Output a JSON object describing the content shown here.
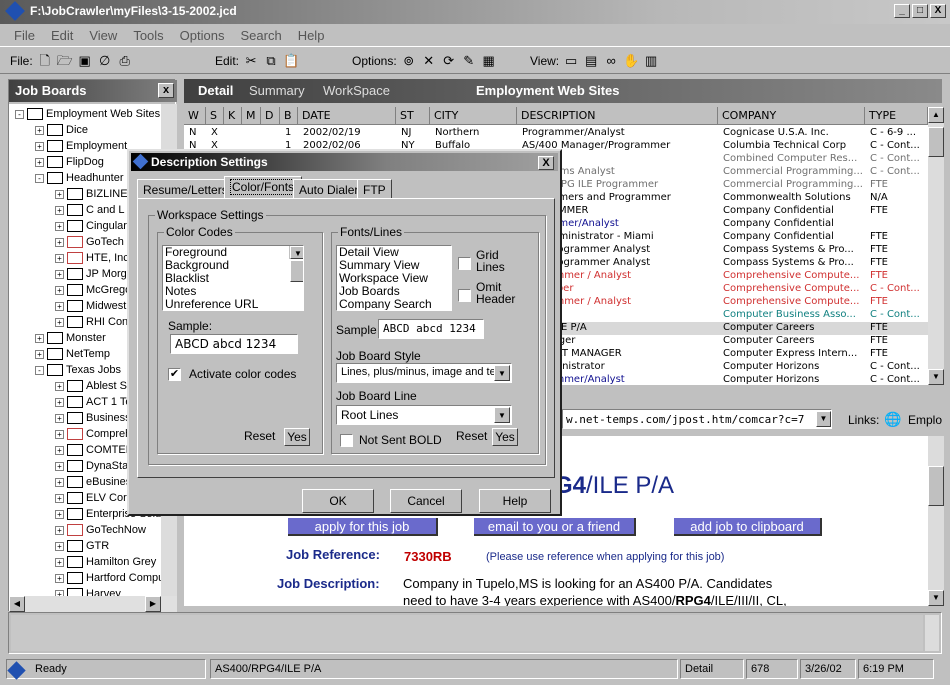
{
  "window": {
    "title": "F:\\JobCrawler\\myFiles\\3-15-2002.jcd",
    "min": "_",
    "max": "□",
    "close": "X"
  },
  "menu": [
    "File",
    "Edit",
    "View",
    "Tools",
    "Options",
    "Search",
    "Help"
  ],
  "toolbar": {
    "file_label": "File:",
    "edit_label": "Edit:",
    "options_label": "Options:",
    "view_label": "View:"
  },
  "left": {
    "title": "Job Boards",
    "close": "x",
    "tree": [
      {
        "label": "Employment Web Sites",
        "level": 0,
        "pm": "-",
        "red": false
      },
      {
        "label": "Dice",
        "level": 1,
        "pm": "+",
        "red": false
      },
      {
        "label": "Employment",
        "level": 1,
        "pm": "+",
        "red": false
      },
      {
        "label": "FlipDog",
        "level": 1,
        "pm": "+",
        "red": false
      },
      {
        "label": "Headhunter",
        "level": 1,
        "pm": "-",
        "red": false
      },
      {
        "label": "BIZLINE",
        "level": 2,
        "pm": "+",
        "red": false
      },
      {
        "label": "C and L",
        "level": 2,
        "pm": "+",
        "red": false
      },
      {
        "label": "Cingular",
        "level": 2,
        "pm": "+",
        "red": false
      },
      {
        "label": "GoTech",
        "level": 2,
        "pm": "+",
        "red": true
      },
      {
        "label": "HTE, Inc",
        "level": 2,
        "pm": "+",
        "red": true
      },
      {
        "label": "JP Morgan",
        "level": 2,
        "pm": "+",
        "red": false
      },
      {
        "label": "McGregor",
        "level": 2,
        "pm": "+",
        "red": false
      },
      {
        "label": "Midwest",
        "level": 2,
        "pm": "+",
        "red": false
      },
      {
        "label": "RHI Consulting",
        "level": 2,
        "pm": "+",
        "red": false
      },
      {
        "label": "Monster",
        "level": 1,
        "pm": "+",
        "red": false
      },
      {
        "label": "NetTemp",
        "level": 1,
        "pm": "+",
        "red": false
      },
      {
        "label": "Texas Jobs",
        "level": 1,
        "pm": "-",
        "red": false
      },
      {
        "label": "Ablest Staffing",
        "level": 2,
        "pm": "+",
        "red": false
      },
      {
        "label": "ACT 1 Technical",
        "level": 2,
        "pm": "+",
        "red": false
      },
      {
        "label": "Business",
        "level": 2,
        "pm": "+",
        "red": false
      },
      {
        "label": "Comprehensive",
        "level": 2,
        "pm": "+",
        "red": true
      },
      {
        "label": "COMTEK",
        "level": 2,
        "pm": "+",
        "red": false
      },
      {
        "label": "DynaStaff",
        "level": 2,
        "pm": "+",
        "red": false
      },
      {
        "label": "eBusiness",
        "level": 2,
        "pm": "+",
        "red": false
      },
      {
        "label": "ELV Corp",
        "level": 2,
        "pm": "+",
        "red": false
      },
      {
        "label": "Enterprise Solutions",
        "level": 2,
        "pm": "+",
        "red": false
      },
      {
        "label": "GoTechNow",
        "level": 2,
        "pm": "+",
        "red": true
      },
      {
        "label": "GTR",
        "level": 2,
        "pm": "+",
        "red": false
      },
      {
        "label": "Hamilton Grey",
        "level": 2,
        "pm": "+",
        "red": false
      },
      {
        "label": "Hartford Computer",
        "level": 2,
        "pm": "+",
        "red": false
      },
      {
        "label": "Harvey",
        "level": 2,
        "pm": "+",
        "red": false
      }
    ]
  },
  "right": {
    "tabs": [
      "Detail",
      "Summary",
      "WorkSpace"
    ],
    "heading": "Employment Web Sites"
  },
  "grid": {
    "columns": [
      "W",
      "S",
      "K",
      "M",
      "D",
      "B",
      "DATE",
      "ST",
      "CITY",
      "DESCRIPTION",
      "COMPANY",
      "TYPE"
    ],
    "rows": [
      {
        "w": "N",
        "s": "X",
        "b": "1",
        "date": "2002/02/19",
        "st": "NJ",
        "city": "Northern",
        "desc": "Programmer/Analyst",
        "company": "Cognicase U.S.A. Inc.",
        "type": "C - 6-9 ...",
        "cc": "black",
        "dc": "black"
      },
      {
        "w": "N",
        "s": "X",
        "b": "1",
        "date": "2002/02/06",
        "st": "NY",
        "city": "Buffalo",
        "desc": "AS/400 Manager/Programmer",
        "company": "Columbia Technical Corp",
        "type": "C - Cont...",
        "cc": "black",
        "dc": "black"
      },
      {
        "w": "",
        "s": "",
        "b": "",
        "date": "",
        "st": "",
        "city": "",
        "desc": "mmer",
        "company": "Combined Computer Res...",
        "type": "C - Cont...",
        "cc": "gray",
        "dc": "gray"
      },
      {
        "w": "",
        "s": "",
        "b": "",
        "date": "",
        "st": "",
        "city": "",
        "desc": "B Systems Analyst",
        "company": "Commercial Programming...",
        "type": "C - Cont...",
        "cc": "gray",
        "dc": "gray"
      },
      {
        "w": "",
        "s": "",
        "b": "",
        "date": "",
        "st": "",
        "city": "",
        "desc": "S/400 RPG ILE Programmer",
        "company": "Commercial Programming...",
        "type": "FTE",
        "cc": "gray",
        "dc": "gray"
      },
      {
        "w": "",
        "s": "",
        "b": "",
        "date": "",
        "st": "",
        "city": "",
        "desc": "rogrammers and Programmer",
        "company": "Commonwealth Solutions",
        "type": "N/A",
        "cc": "black",
        "dc": "black"
      },
      {
        "w": "",
        "s": "",
        "b": "",
        "date": "",
        "st": "",
        "city": "",
        "desc": "ROGRAMMER",
        "company": "Company Confidential",
        "type": "FTE",
        "cc": "black",
        "dc": "black"
      },
      {
        "w": "",
        "s": "",
        "b": "",
        "date": "",
        "st": "",
        "city": "",
        "desc": "rogrammer/Analyst",
        "company": "Company Confidential",
        "type": "",
        "cc": "black",
        "dc": "blue"
      },
      {
        "w": "",
        "s": "",
        "b": "",
        "date": "",
        "st": "",
        "city": "",
        "desc": "rver Administrator - Miami",
        "company": "Company Confidential",
        "type": "FTE",
        "cc": "black",
        "dc": "black"
      },
      {
        "w": "",
        "s": "",
        "b": "",
        "date": "",
        "st": "",
        "city": "",
        "desc": "/400 Programmer Analyst",
        "company": "Compass Systems & Pro...",
        "type": "FTE",
        "cc": "black",
        "dc": "black"
      },
      {
        "w": "",
        "s": "",
        "b": "",
        "date": "",
        "st": "",
        "city": "",
        "desc": "/400 Programmer Analyst",
        "company": "Compass Systems & Pro...",
        "type": "FTE",
        "cc": "black",
        "dc": "black"
      },
      {
        "w": "",
        "s": "",
        "b": "",
        "date": "",
        "st": "",
        "city": "",
        "desc": "Programmer / Analyst",
        "company": "Comprehensive Compute...",
        "type": "FTE",
        "cc": "red",
        "dc": "red"
      },
      {
        "w": "",
        "s": "",
        "b": "",
        "date": "",
        "st": "",
        "city": "",
        "desc": "Developer",
        "company": "Comprehensive Compute...",
        "type": "C - Cont...",
        "cc": "red",
        "dc": "red"
      },
      {
        "w": "",
        "s": "",
        "b": "",
        "date": "",
        "st": "",
        "city": "",
        "desc": "Programmer / Analyst",
        "company": "Comprehensive Compute...",
        "type": "FTE",
        "cc": "red",
        "dc": "red"
      },
      {
        "w": "",
        "s": "",
        "b": "",
        "date": "",
        "st": "",
        "city": "",
        "desc": "n Lead",
        "company": "Computer Business Asso...",
        "type": "C - Cont...",
        "cc": "teal",
        "dc": "teal"
      },
      {
        "w": "",
        "s": "",
        "b": "",
        "date": "",
        "st": "",
        "city": "",
        "desc": "RPG4/ILE P/A",
        "company": "Computer Careers",
        "type": "FTE",
        "cc": "black",
        "dc": "black",
        "sel": true
      },
      {
        "w": "",
        "s": "",
        "b": "",
        "date": "",
        "st": "",
        "city": "",
        "desc": "S Manager",
        "company": "Computer Careers",
        "type": "FTE",
        "cc": "black",
        "dc": "black"
      },
      {
        "w": "",
        "s": "",
        "b": "",
        "date": "",
        "st": "",
        "city": "",
        "desc": "SUPPORT MANAGER",
        "company": "Computer Express Intern...",
        "type": "FTE",
        "cc": "black",
        "dc": "black"
      },
      {
        "w": "",
        "s": "",
        "b": "",
        "date": "",
        "st": "",
        "city": "",
        "desc": "se Administrator",
        "company": "Computer Horizons",
        "type": "C - Cont...",
        "cc": "black",
        "dc": "black"
      },
      {
        "w": "",
        "s": "",
        "b": "",
        "date": "",
        "st": "",
        "city": "",
        "desc": "Programmer/Analyst",
        "company": "Computer Horizons",
        "type": "C - Cont...",
        "cc": "black",
        "dc": "blue"
      }
    ]
  },
  "urlbar": {
    "url": "w.net-temps.com/jpost.htm/comcar?c=7",
    "links": "Links:",
    "emplo": "Emplo"
  },
  "browser": {
    "heading_bold": "G4",
    "heading_rest": "/ILE P/A",
    "btn_apply": "apply for this job",
    "btn_email": "email to you or a friend",
    "btn_clip": "add job to clipboard",
    "ref_label": "Job Reference:",
    "ref_value": "7330RB",
    "ref_note": "(Please use reference when applying for this job)",
    "desc_label": "Job Description:",
    "desc_line1": "Company in Tupelo,MS is looking for an AS400 P/A. Candidates",
    "desc_line2_a": "need to have 3-4 years experience with AS400/",
    "desc_line2_b": "RPG4",
    "desc_line2_c": "/ILE/III/II, CL,"
  },
  "status": {
    "ready": "Ready",
    "job": "AS400/RPG4/ILE P/A",
    "view": "Detail",
    "count": "678",
    "date": "3/26/02",
    "time": "6:19 PM"
  },
  "dialog": {
    "title": "Description Settings",
    "close": "X",
    "tabs": [
      "Resume/Letters",
      "Color/Fonts",
      "Auto Dialer",
      "FTP"
    ],
    "workspace_group": "Workspace Settings",
    "color_codes_group": "Color Codes",
    "color_codes": [
      "Foreground",
      "Background",
      "Blacklist",
      "Notes",
      "Unreference URL"
    ],
    "sample_label": "Sample:",
    "sample_text": "ABCD abcd 1234",
    "activate": "Activate color codes",
    "activate_checked": true,
    "reset": "Reset",
    "yes": "Yes",
    "fonts_group": "Fonts/Lines",
    "fonts_list": [
      "Detail View",
      "Summary View",
      "Workspace View",
      "Job Boards",
      "Company Search"
    ],
    "grid_lines": "Grid Lines",
    "omit_header": "Omit Header",
    "sample2_label": "Sample",
    "sample2_text": "ABCD abcd 1234",
    "style_label": "Job Board Style",
    "style_value": "Lines, plus/minus, image and text",
    "line_label": "Job Board Line",
    "line_value": "Root Lines",
    "not_bold": "Not Sent BOLD",
    "ok": "OK",
    "cancel": "Cancel",
    "help": "Help"
  }
}
